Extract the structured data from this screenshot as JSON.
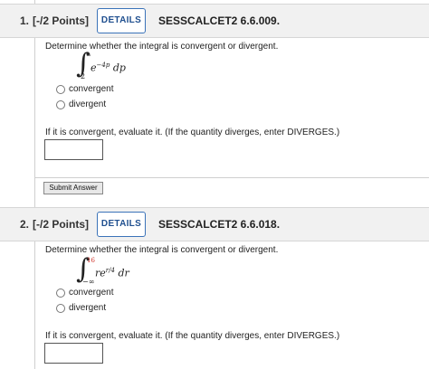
{
  "questions": [
    {
      "number": "1.",
      "points": "[-/2 Points]",
      "details_label": "DETAILS",
      "code": "SESSCALCET2 6.6.009.",
      "prompt": "Determine whether the integral is convergent or divergent.",
      "integral": {
        "lower": "2",
        "upper": "∞",
        "integrand_base": "e",
        "integrand_exponent": "−4p",
        "differential": "dp"
      },
      "options": [
        "convergent",
        "divergent"
      ],
      "evaluate_text": "If it is convergent, evaluate it. (If the quantity diverges, enter DIVERGES.)",
      "submit_label": "Submit Answer"
    },
    {
      "number": "2.",
      "points": "[-/2 Points]",
      "details_label": "DETAILS",
      "code": "SESSCALCET2 6.6.018.",
      "prompt": "Determine whether the integral is convergent or divergent.",
      "integral": {
        "lower": "−∞",
        "upper": "16",
        "integrand_base": "re",
        "integrand_exponent": "r/4",
        "differential": "dr"
      },
      "options": [
        "convergent",
        "divergent"
      ],
      "evaluate_text": "If it is convergent, evaluate it. (If the quantity diverges, enter DIVERGES.)"
    }
  ],
  "colors": {
    "details_border": "#3b73b9",
    "header_bg": "#f1f1f1",
    "upper_limit_q2": "#d0342c"
  }
}
